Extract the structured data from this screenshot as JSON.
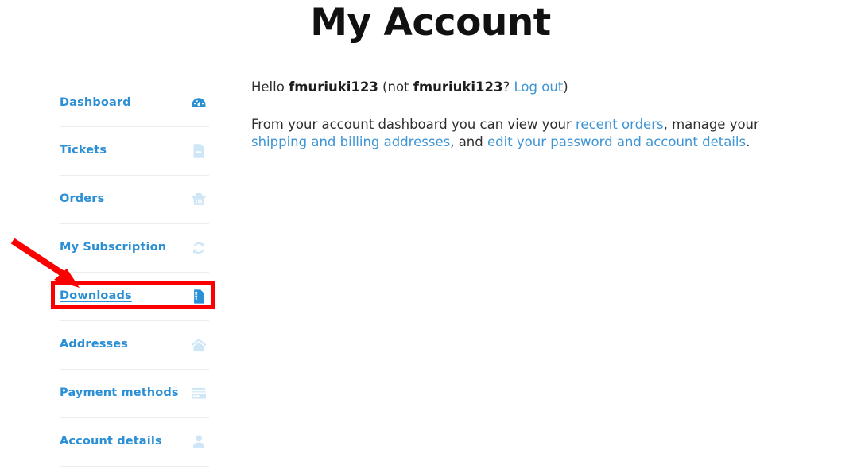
{
  "page": {
    "title": "My Account",
    "accent_blue": "#2a8fd5",
    "link_blue": "#3d95d6",
    "icon_pale": "#cfe6f7",
    "annotation_red": "#fa0000",
    "divider": "#ececec",
    "background": "#ffffff"
  },
  "sidebar": {
    "items": [
      {
        "label": "Dashboard",
        "icon": "dashboard-gauge-icon",
        "active": false
      },
      {
        "label": "Tickets",
        "icon": "document-icon",
        "active": false
      },
      {
        "label": "Orders",
        "icon": "shopping-basket-icon",
        "active": false
      },
      {
        "label": "My Subscription",
        "icon": "refresh-cycle-icon",
        "active": false
      },
      {
        "label": "Downloads",
        "icon": "file-download-icon",
        "active": true
      },
      {
        "label": "Addresses",
        "icon": "home-icon",
        "active": false
      },
      {
        "label": "Payment methods",
        "icon": "credit-card-icon",
        "active": false
      },
      {
        "label": "Account details",
        "icon": "user-profile-icon",
        "active": false
      }
    ]
  },
  "main": {
    "greeting": {
      "hello": "Hello ",
      "username": "fmuriuki123",
      "not_prefix": " (not ",
      "username_again": "fmuriuki123",
      "question": "? ",
      "logout_label": "Log out",
      "close_paren": ")"
    },
    "description": {
      "part1": "From your account dashboard you can view your ",
      "link_recent_orders": "recent orders",
      "part2": ", manage your ",
      "link_addresses": "shipping and billing addresses",
      "part3": ", and ",
      "link_account_details": "edit your password and account details",
      "part4": "."
    }
  },
  "annotation": {
    "arrow_name": "red-pointer-arrow",
    "box_name": "red-highlight-box",
    "target": "Downloads"
  }
}
